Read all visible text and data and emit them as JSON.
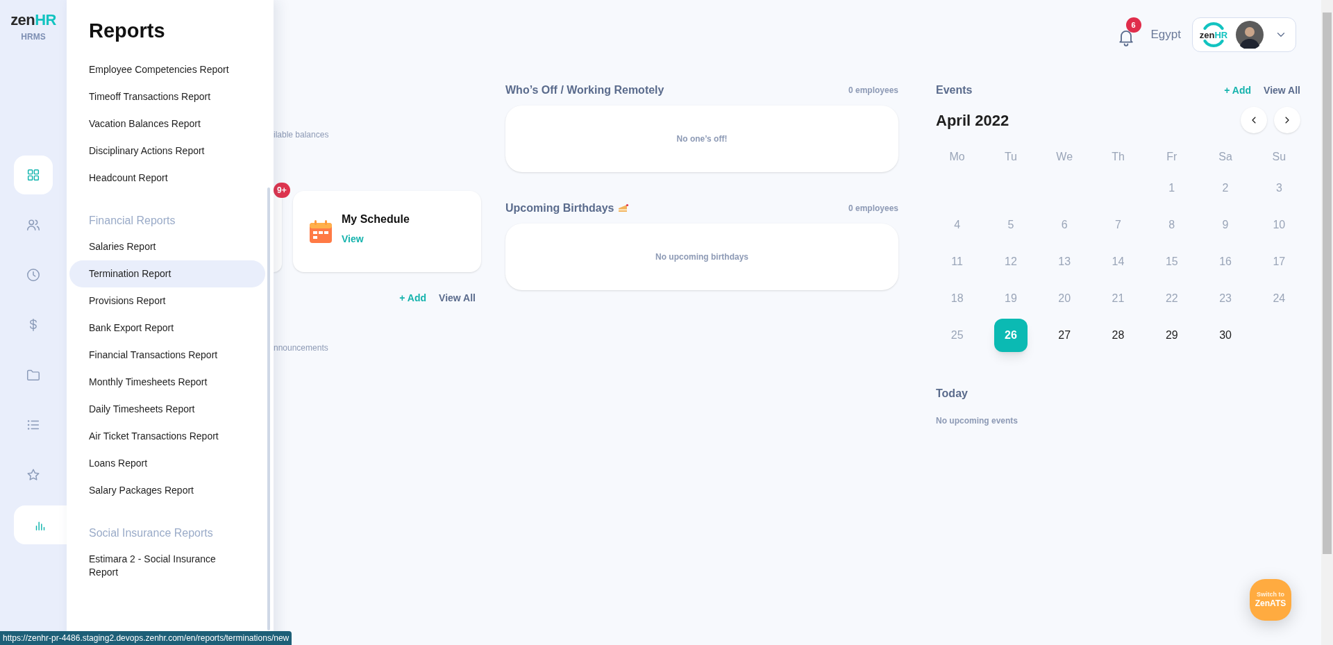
{
  "logo": {
    "word": "zen",
    "accent": "HR",
    "product": "HRMS"
  },
  "rail": [
    {
      "selected": true
    },
    {
      "selected": false
    },
    {
      "selected": false
    },
    {
      "selected": false
    },
    {
      "selected": false
    },
    {
      "selected": false
    },
    {
      "selected": false
    },
    {
      "selected": true
    }
  ],
  "reports_menu": {
    "title": "Reports",
    "sections": [
      {
        "items": [
          {
            "label": "Employee Competencies Report",
            "selected": false
          },
          {
            "label": "Timeoff Transactions Report",
            "selected": false
          },
          {
            "label": "Vacation Balances Report",
            "selected": false
          },
          {
            "label": "Disciplinary Actions Report",
            "selected": false
          },
          {
            "label": "Headcount Report",
            "selected": false
          }
        ]
      },
      {
        "heading": "Financial Reports",
        "items": [
          {
            "label": "Salaries Report",
            "selected": false
          },
          {
            "label": "Termination Report",
            "selected": true
          },
          {
            "label": "Provisions Report",
            "selected": false
          },
          {
            "label": "Bank Export Report",
            "selected": false
          },
          {
            "label": "Financial Transactions Report",
            "selected": false
          },
          {
            "label": "Monthly Timesheets Report",
            "selected": false
          },
          {
            "label": "Daily Timesheets Report",
            "selected": false
          },
          {
            "label": "Air Ticket Transactions Report",
            "selected": false
          },
          {
            "label": "Loans Report",
            "selected": false
          },
          {
            "label": "Salary Packages Report",
            "selected": false
          }
        ]
      },
      {
        "heading": "Social Insurance Reports",
        "items": [
          {
            "label": "Estimara 2 - Social Insurance Report",
            "selected": false
          }
        ]
      }
    ]
  },
  "left_column": {
    "balances_text": "ilable balances",
    "badge": "9+",
    "schedule_card": {
      "title": "My Schedule",
      "link": "View"
    },
    "actions": [
      {
        "label": "+ Add",
        "kind": "add"
      },
      {
        "label": "View All",
        "kind": "view"
      }
    ],
    "announcements_text": "nnouncements"
  },
  "whos_off": {
    "title": "Who’s Off / Working Remotely",
    "count": "0 employees",
    "empty_text": "No one’s off!"
  },
  "birthdays": {
    "title": "Upcoming Birthdays",
    "count": "0 employees",
    "empty_text": "No upcoming birthdays"
  },
  "header": {
    "notification_count": "6",
    "country": "Egypt",
    "profile_logo": {
      "word": "zen",
      "accent": "HR"
    }
  },
  "events": {
    "title": "Events",
    "actions": [
      {
        "label": "+ Add",
        "kind": "add"
      },
      {
        "label": "View All",
        "kind": "view"
      }
    ],
    "month": "April 2022",
    "weekdays": [
      "Mo",
      "Tu",
      "We",
      "Th",
      "Fr",
      "Sa",
      "Su"
    ],
    "weeks": [
      [
        {
          "kind": "blank"
        },
        {
          "kind": "blank"
        },
        {
          "kind": "blank"
        },
        {
          "kind": "blank"
        },
        {
          "kind": "day",
          "label": "1",
          "past": true,
          "selected": false
        },
        {
          "kind": "day",
          "label": "2",
          "past": true,
          "selected": false
        },
        {
          "kind": "day",
          "label": "3",
          "past": true,
          "selected": false
        }
      ],
      [
        {
          "kind": "day",
          "label": "4",
          "past": true,
          "selected": false
        },
        {
          "kind": "day",
          "label": "5",
          "past": true,
          "selected": false
        },
        {
          "kind": "day",
          "label": "6",
          "past": true,
          "selected": false
        },
        {
          "kind": "day",
          "label": "7",
          "past": true,
          "selected": false
        },
        {
          "kind": "day",
          "label": "8",
          "past": true,
          "selected": false
        },
        {
          "kind": "day",
          "label": "9",
          "past": true,
          "selected": false
        },
        {
          "kind": "day",
          "label": "10",
          "past": true,
          "selected": false
        }
      ],
      [
        {
          "kind": "day",
          "label": "11",
          "past": true,
          "selected": false
        },
        {
          "kind": "day",
          "label": "12",
          "past": true,
          "selected": false
        },
        {
          "kind": "day",
          "label": "13",
          "past": true,
          "selected": false
        },
        {
          "kind": "day",
          "label": "14",
          "past": true,
          "selected": false
        },
        {
          "kind": "day",
          "label": "15",
          "past": true,
          "selected": false
        },
        {
          "kind": "day",
          "label": "16",
          "past": true,
          "selected": false
        },
        {
          "kind": "day",
          "label": "17",
          "past": true,
          "selected": false
        }
      ],
      [
        {
          "kind": "day",
          "label": "18",
          "past": true,
          "selected": false
        },
        {
          "kind": "day",
          "label": "19",
          "past": true,
          "selected": false
        },
        {
          "kind": "day",
          "label": "20",
          "past": true,
          "selected": false
        },
        {
          "kind": "day",
          "label": "21",
          "past": true,
          "selected": false
        },
        {
          "kind": "day",
          "label": "22",
          "past": true,
          "selected": false
        },
        {
          "kind": "day",
          "label": "23",
          "past": true,
          "selected": false
        },
        {
          "kind": "day",
          "label": "24",
          "past": true,
          "selected": false
        }
      ],
      [
        {
          "kind": "day",
          "label": "25",
          "past": true,
          "selected": false
        },
        {
          "kind": "day",
          "label": "26",
          "past": false,
          "selected": true
        },
        {
          "kind": "day",
          "label": "27",
          "past": false,
          "selected": false
        },
        {
          "kind": "day",
          "label": "28",
          "past": false,
          "selected": false
        },
        {
          "kind": "day",
          "label": "29",
          "past": false,
          "selected": false
        },
        {
          "kind": "day",
          "label": "30",
          "past": false,
          "selected": false
        },
        {
          "kind": "blank"
        }
      ]
    ],
    "today_title": "Today",
    "today_empty": "No upcoming events"
  },
  "switch_button": {
    "line1": "Switch to",
    "line2": "ZenATS"
  },
  "status_url": "https://zenhr-pr-4486.staging2.devops.zenhr.com/en/reports/terminations/new"
}
